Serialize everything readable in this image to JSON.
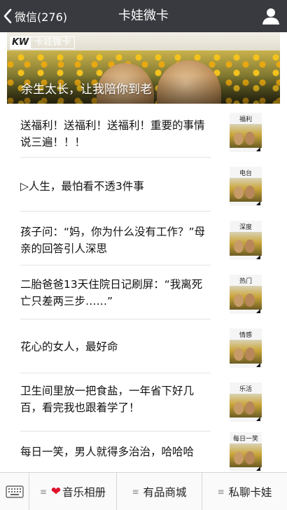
{
  "nav": {
    "back_label": "微信(276)",
    "title": "卡娃微卡"
  },
  "banner": {
    "logo_mark": "KW",
    "logo_text": "卡娃微卡",
    "caption": "余生太长，让我陪你到老"
  },
  "articles": [
    {
      "title": "送福利！送福利！送福利！重要的事情说三遍！！！",
      "tag": "福利"
    },
    {
      "title": "▷人生，最怕看不透3件事",
      "tag": "电台"
    },
    {
      "title": "孩子问：“妈，你为什么没有工作？”母亲的回答引人深思",
      "tag": "深度"
    },
    {
      "title": "二胎爸爸13天住院日记刷屏：“我离死亡只差两三步……”",
      "tag": "热门"
    },
    {
      "title": "花心的女人，最好命",
      "tag": "情感"
    },
    {
      "title": "卫生间里放一把食盐，一年省下好几百，看完我也跟着学了！",
      "tag": "乐活"
    },
    {
      "title": "每日一笑，男人就得多治治，哈哈哈",
      "tag": "每日一笑"
    }
  ],
  "tabbar": {
    "tab1": "音乐相册",
    "tab2": "有品商城",
    "tab3": "私聊卡娃",
    "menu_glyph": "≡",
    "heart_glyph": "❤"
  },
  "colors": {
    "navbar_bg": "#393a3f",
    "heart": "#e0112b"
  },
  "icons": [
    "back-chevron-icon",
    "user-icon",
    "keyboard-icon",
    "menu-icon",
    "heart-icon"
  ]
}
